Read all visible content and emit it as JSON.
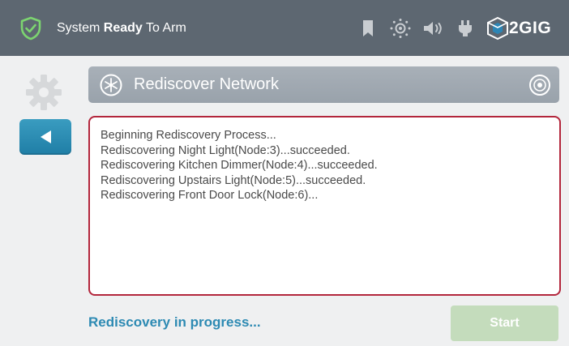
{
  "header": {
    "status_prefix": "System",
    "status_bold": "Ready",
    "status_suffix": "To Arm",
    "brand": "2GIG",
    "icons": [
      "shield-check-icon",
      "bookmark-icon",
      "brightness-icon",
      "volume-icon",
      "plug-icon",
      "cube-logo-icon"
    ]
  },
  "page": {
    "title": "Rediscover Network",
    "title_icon": "network-snowflake-icon",
    "title_right_icon": "target-icon"
  },
  "sidebar": {
    "settings_icon": "gear-icon",
    "back_icon": "back-arrow-icon"
  },
  "log": {
    "lines": [
      "Beginning Rediscovery Process...",
      "Rediscovering Night Light(Node:3)...succeeded.",
      "Rediscovering Kitchen Dimmer(Node:4)...succeeded.",
      "Rediscovering Upstairs Light(Node:5)...succeeded.",
      "Rediscovering Front Door Lock(Node:6)..."
    ]
  },
  "footer": {
    "progress_text": "Rediscovery in progress...",
    "start_label": "Start"
  },
  "colors": {
    "header_bg": "#5d6771",
    "accent_green": "#7cd470",
    "log_border": "#b3263c",
    "progress_text": "#2d8ab3",
    "start_disabled": "#c4dcbc",
    "back_button": "#2b8db5"
  }
}
